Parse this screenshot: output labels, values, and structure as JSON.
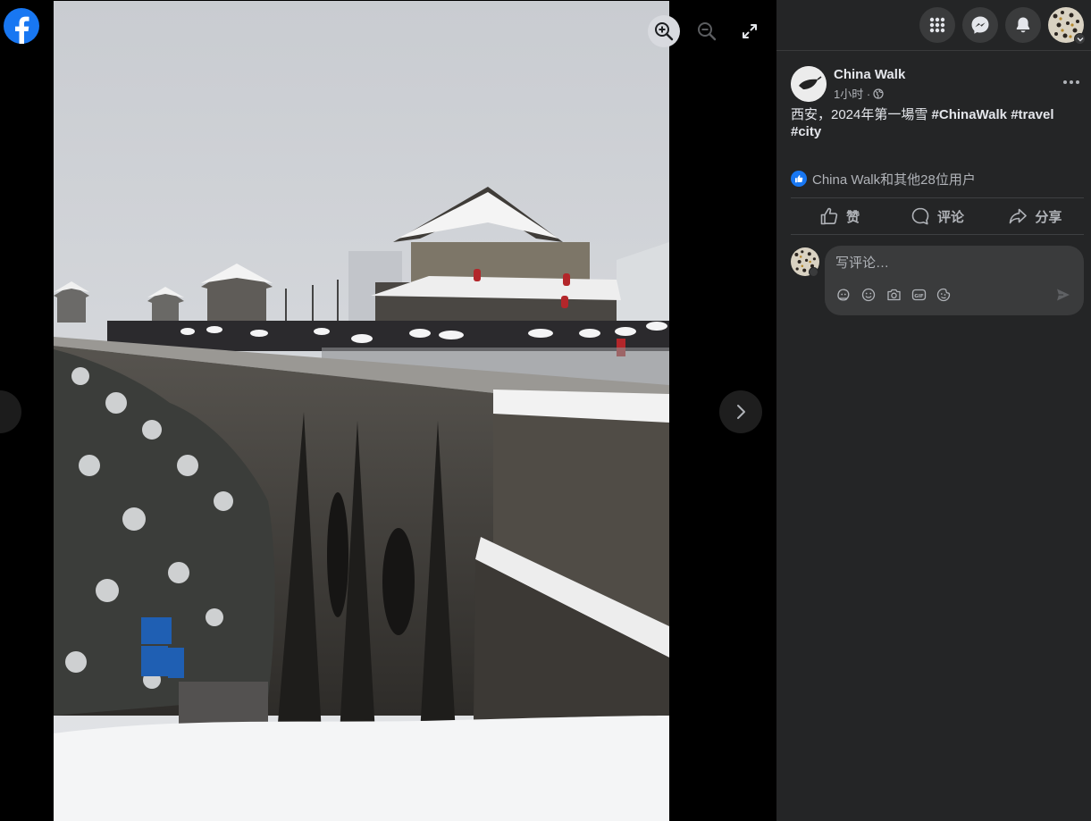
{
  "app": {
    "logo": "facebook-logo-icon"
  },
  "viewer": {
    "tools": [
      "zoom-in-icon",
      "zoom-out-icon",
      "fullscreen-icon"
    ],
    "next_icon": "chevron-right-icon"
  },
  "topbar": {
    "icons": [
      "menu-grid-icon",
      "messenger-icon",
      "bell-icon",
      "account-avatar"
    ]
  },
  "post": {
    "page_name": "China Walk",
    "time": "1小时 ·",
    "audience_icon": "globe-icon",
    "text_plain": "西安，2024年第一場雪 ",
    "hashtags": [
      "#ChinaWalk",
      "#travel",
      "#city"
    ],
    "reactions_text": "China Walk和其他28位用户"
  },
  "actions": {
    "like": "赞",
    "comment": "评论",
    "share": "分享"
  },
  "comment": {
    "placeholder": "写评论…",
    "tools": [
      "avatar-sticker-icon",
      "emoji-icon",
      "camera-icon",
      "gif-icon",
      "sticker-icon"
    ],
    "send_icon": "send-icon"
  },
  "colors": {
    "panel_bg": "#242526",
    "accent": "#1877f2",
    "secondary_text": "#b0b3b8"
  }
}
